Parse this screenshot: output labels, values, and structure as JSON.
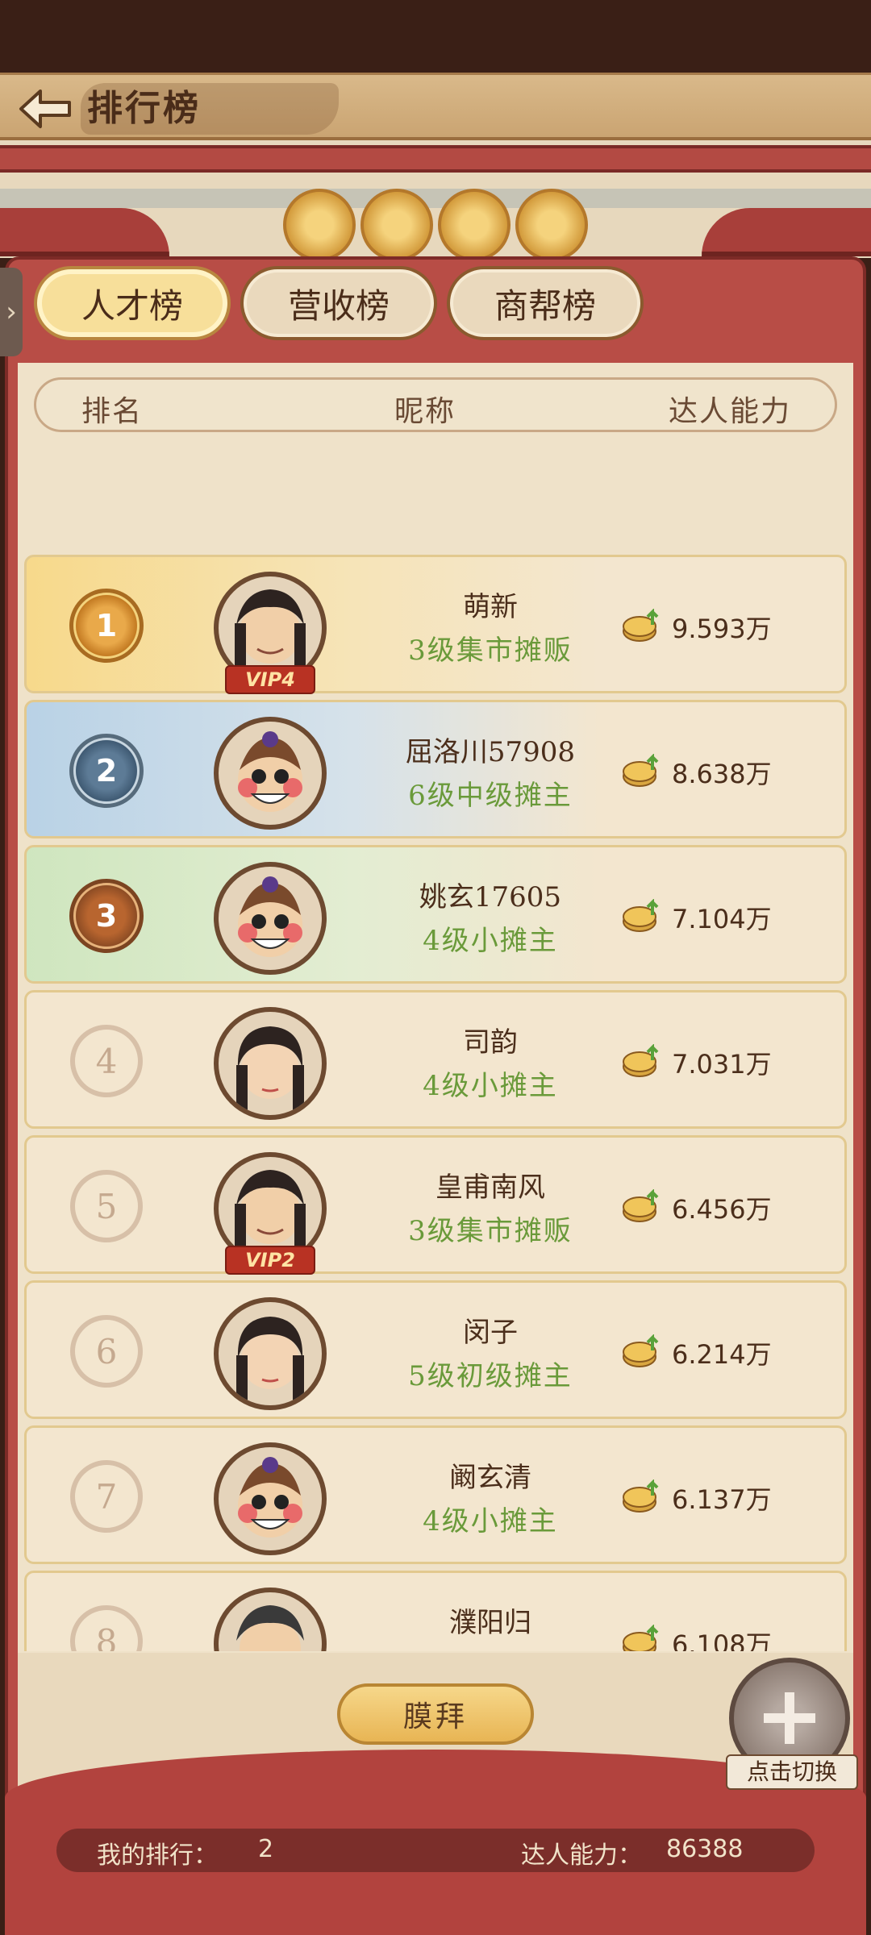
{
  "header": {
    "title": "排行榜"
  },
  "tabs": [
    {
      "label": "人才榜",
      "active": true
    },
    {
      "label": "营收榜",
      "active": false
    },
    {
      "label": "商帮榜",
      "active": false
    }
  ],
  "table_headers": {
    "rank": "排名",
    "nickname": "昵称",
    "power": "达人能力"
  },
  "rows": [
    {
      "rank": "1",
      "name": "萌新",
      "level": "3级集市摊贩",
      "score": "9.593万",
      "vip": "VIP4",
      "avatar": "male-avatar"
    },
    {
      "rank": "2",
      "name": "屈洛川57908",
      "level": "6级中级摊主",
      "score": "8.638万",
      "vip": "",
      "avatar": "clown-avatar"
    },
    {
      "rank": "3",
      "name": "姚玄17605",
      "level": "4级小摊主",
      "score": "7.104万",
      "vip": "",
      "avatar": "clown-avatar"
    },
    {
      "rank": "4",
      "name": "司韵",
      "level": "4级小摊主",
      "score": "7.031万",
      "vip": "",
      "avatar": "female-avatar"
    },
    {
      "rank": "5",
      "name": "皇甫南风",
      "level": "3级集市摊贩",
      "score": "6.456万",
      "vip": "VIP2",
      "avatar": "male-avatar"
    },
    {
      "rank": "6",
      "name": "闵子",
      "level": "5级初级摊主",
      "score": "6.214万",
      "vip": "",
      "avatar": "female-avatar"
    },
    {
      "rank": "7",
      "name": "阚玄清",
      "level": "4级小摊主",
      "score": "6.137万",
      "vip": "",
      "avatar": "clown-avatar"
    },
    {
      "rank": "8",
      "name": "濮阳归",
      "level": "",
      "score": "6.108万",
      "vip": "",
      "avatar": "male-avatar"
    }
  ],
  "worship_label": "膜拜",
  "switch_label": "点击切换",
  "my_rank": {
    "label": "我的排行：",
    "value": "2"
  },
  "my_power": {
    "label": "达人能力：",
    "value": "86388"
  },
  "colors": {
    "frame_red": "#b84d46",
    "level_green": "#6a9a3a",
    "paper": "#efe2c9"
  }
}
